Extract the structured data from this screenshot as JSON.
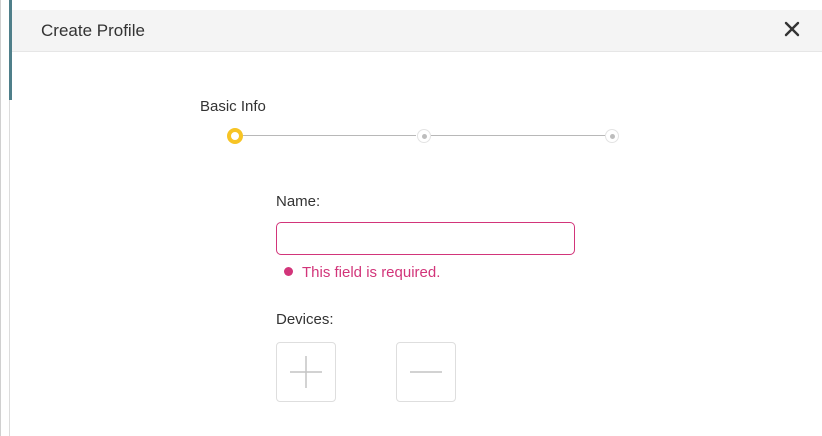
{
  "dialog": {
    "title": "Create Profile",
    "close_icon": "close-icon"
  },
  "stepper": {
    "current_step_label": "Basic Info",
    "steps": 3,
    "active_step": 1,
    "active_color": "#f7c425"
  },
  "form": {
    "name_label": "Name:",
    "name_value": "",
    "name_placeholder": "",
    "error_text": "This field is required.",
    "error_color": "#d2357a",
    "devices_label": "Devices:",
    "add_icon": "plus-icon",
    "remove_icon": "minus-icon"
  }
}
